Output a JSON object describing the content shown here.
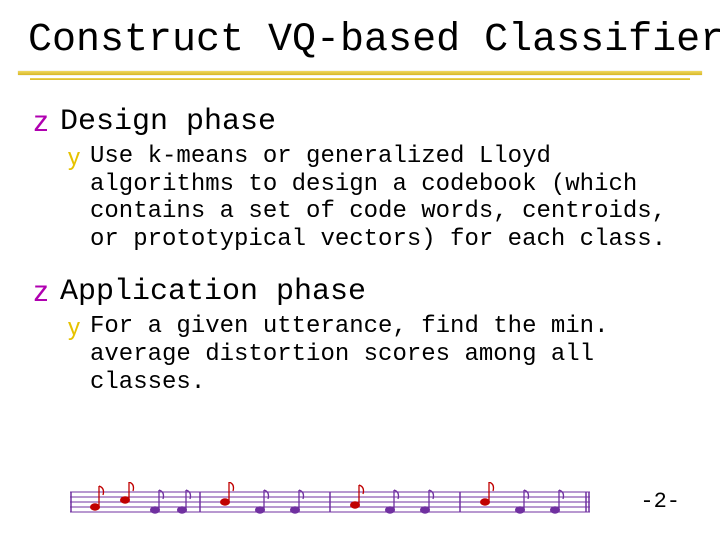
{
  "title": "Construct VQ-based Classifiers",
  "sections": [
    {
      "bullet_glyph": "z",
      "heading": "Design phase",
      "item_bullet_glyph": "y",
      "body": "Use k-means or generalized Lloyd algorithms to design a codebook (which contains a set of code words, centroids, or prototypical vectors) for each class."
    },
    {
      "bullet_glyph": "z",
      "heading": "Application phase",
      "item_bullet_glyph": "y",
      "body": "For a given utterance, find the min. average distortion scores among all classes."
    }
  ],
  "page_number": "-2-",
  "decor": {
    "staff_color": "#7030a0",
    "note_colors": [
      "#c00000",
      "#c00000",
      "#7030a0",
      "#7030a0",
      "#c00000",
      "#7030a0",
      "#7030a0",
      "#c00000",
      "#7030a0",
      "#7030a0",
      "#c00000",
      "#7030a0"
    ]
  }
}
